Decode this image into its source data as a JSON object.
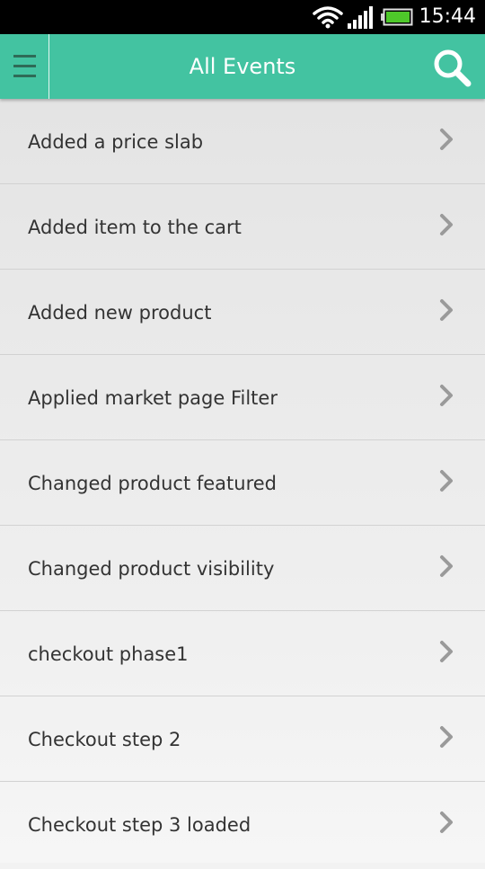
{
  "status_bar": {
    "time": "15:44",
    "icons": [
      "wifi-icon",
      "signal-icon",
      "battery-icon"
    ]
  },
  "app_bar": {
    "title": "All Events",
    "menu_icon": "hamburger-menu-icon",
    "search_icon": "search-icon"
  },
  "colors": {
    "accent": "#43c3a1",
    "status_bar": "#000000",
    "text": "#333333",
    "chevron": "#9a9a9a"
  },
  "events": [
    {
      "label": "Added a price slab"
    },
    {
      "label": "Added item to the cart"
    },
    {
      "label": "Added new product"
    },
    {
      "label": "Applied market page Filter"
    },
    {
      "label": "Changed product featured"
    },
    {
      "label": "Changed product visibility"
    },
    {
      "label": "checkout phase1"
    },
    {
      "label": "Checkout step 2"
    },
    {
      "label": "Checkout step 3 loaded"
    }
  ]
}
